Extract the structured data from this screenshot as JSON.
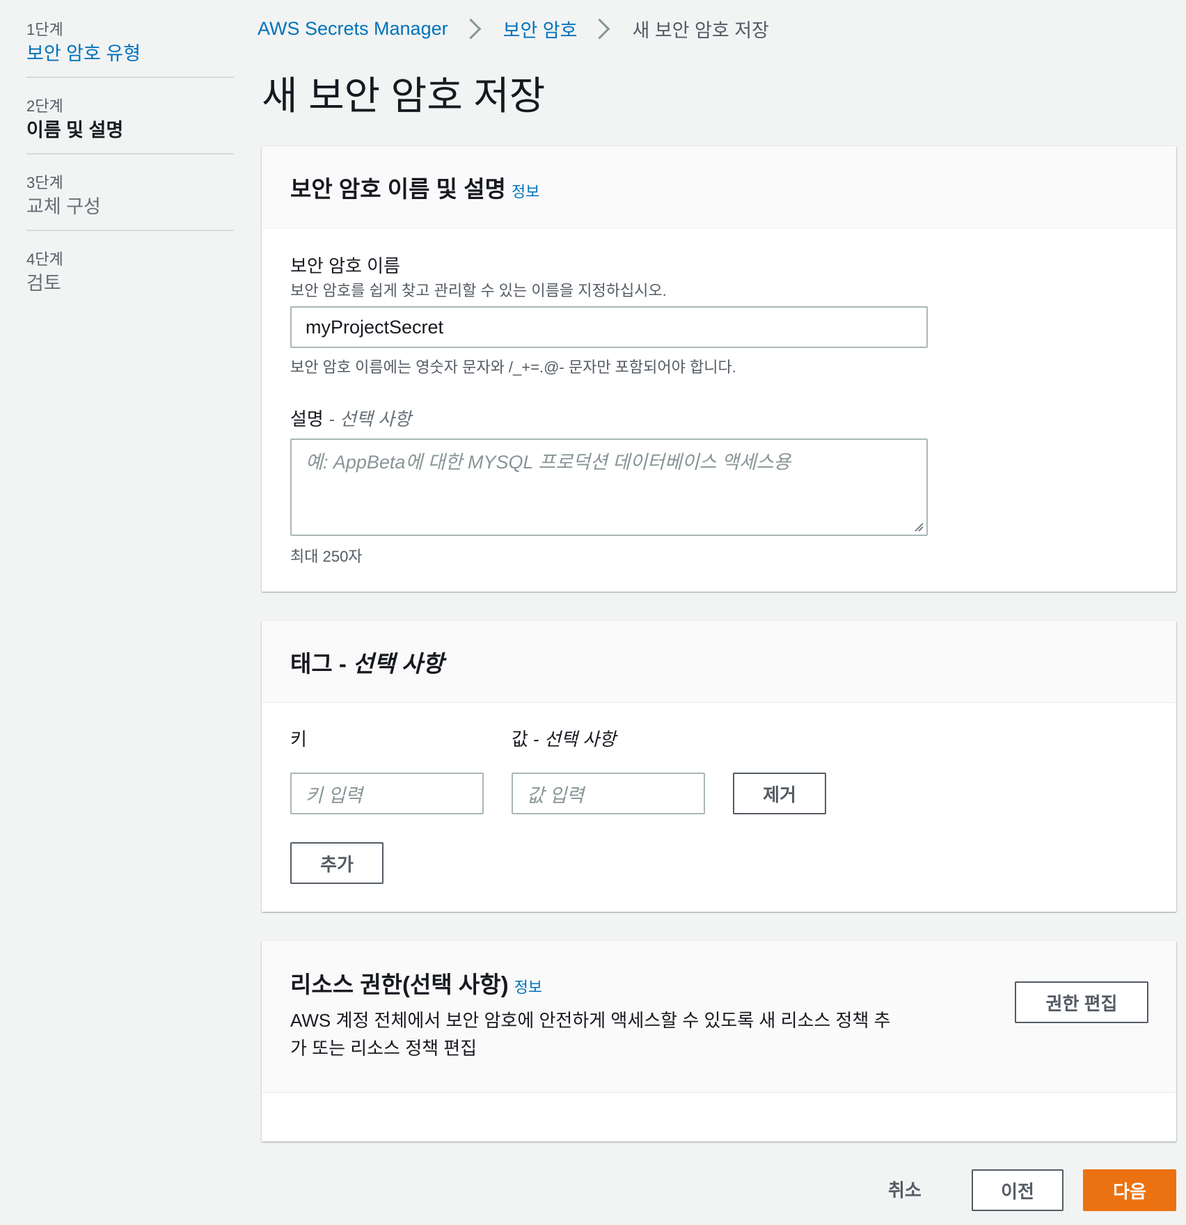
{
  "wizard_steps": [
    {
      "num": "1단계",
      "label": "보안 암호 유형"
    },
    {
      "num": "2단계",
      "label": "이름 및 설명"
    },
    {
      "num": "3단계",
      "label": "교체 구성"
    },
    {
      "num": "4단계",
      "label": "검토"
    }
  ],
  "breadcrumb": [
    "AWS Secrets Manager",
    "보안 암호",
    "새 보안 암호 저장"
  ],
  "page_title": "새 보안 암호 저장",
  "name_panel": {
    "title": "보안 암호 이름 및 설명",
    "info": "정보",
    "name_label": "보안 암호 이름",
    "name_desc": "보안 암호를 쉽게 찾고 관리할 수 있는 이름을 지정하십시오.",
    "name_value": "myProjectSecret",
    "name_constraint": "보안 암호 이름에는 영숫자 문자와 /_+=.@- 문자만 포함되어야 합니다.",
    "desc_label": "설명",
    "desc_optional": " - 선택 사항",
    "desc_placeholder": "예: AppBeta에 대한 MYSQL 프로덕션 데이터베이스 액세스용",
    "desc_constraint": "최대 250자"
  },
  "tags_panel": {
    "title": "태그 - ",
    "title_optional": "선택 사항",
    "key_label": "키",
    "value_label": "값 - ",
    "value_optional": "선택 사항",
    "key_placeholder": "키 입력",
    "value_placeholder": "값 입력",
    "remove_button": "제거",
    "add_button": "추가"
  },
  "resource_panel": {
    "title": "리소스 권한(선택 사항)",
    "info": "정보",
    "desc_line1": "AWS 계정 전체에서 보안 암호에 안전하게 액세스할 수 있도록 새 리소스 정책 추",
    "desc_line2": "가 또는 리소스 정책 편집",
    "edit_button": "권한 편집"
  },
  "footer": {
    "cancel": "취소",
    "previous": "이전",
    "next": "다음"
  },
  "colors": {
    "link": "#0073bb",
    "primary": "#ec7211",
    "background": "#f2f3f3"
  }
}
